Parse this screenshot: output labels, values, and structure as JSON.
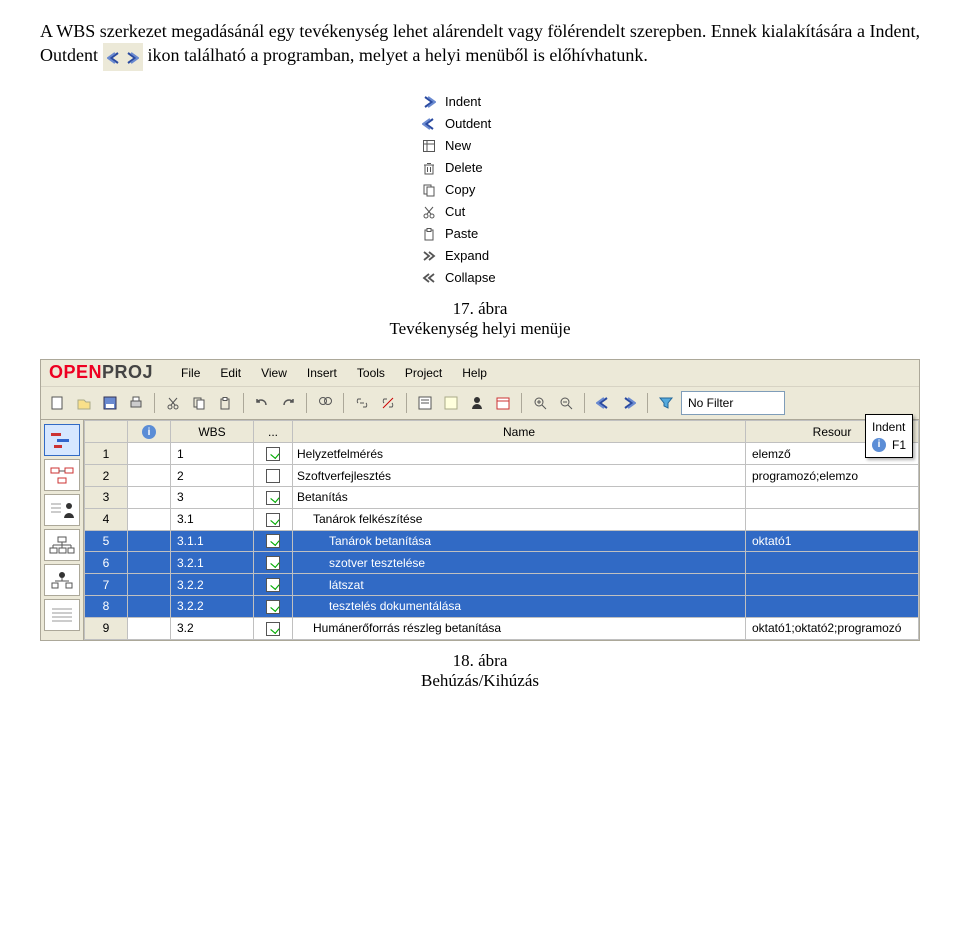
{
  "para1_a": "A WBS szerkezet megadásánál egy tevékenység lehet alárendelt vagy fölérendelt szerepben. Ennek kialakítására a Indent, Outdent",
  "para1_b": "ikon található a programban, melyet a helyi menüből is előhívhatunk.",
  "caption17_a": "17. ábra",
  "caption17_b": "Tevékenység helyi menüje",
  "caption18_a": "18. ábra",
  "caption18_b": "Behúzás/Kihúzás",
  "context_menu": {
    "items": [
      {
        "label": "Indent"
      },
      {
        "label": "Outdent"
      },
      {
        "label": "New"
      },
      {
        "label": "Delete"
      },
      {
        "label": "Copy"
      },
      {
        "label": "Cut"
      },
      {
        "label": "Paste"
      },
      {
        "label": "Expand"
      },
      {
        "label": "Collapse"
      }
    ]
  },
  "app": {
    "logo_open": "OPEN",
    "logo_proj": "PROJ",
    "menus": [
      "File",
      "Edit",
      "View",
      "Insert",
      "Tools",
      "Project",
      "Help"
    ],
    "filter_text": "No Filter",
    "tooltip": {
      "title": "Indent",
      "shortcut": "F1"
    },
    "columns": {
      "info": "",
      "wbs": "WBS",
      "dots": "...",
      "name": "Name",
      "resource": "Resour"
    },
    "rows": [
      {
        "n": "1",
        "wbs": "1",
        "chk": true,
        "name": "Helyzetfelmérés",
        "res": "elemző",
        "sel": false,
        "indent": 0
      },
      {
        "n": "2",
        "wbs": "2",
        "chk": false,
        "name": "Szoftverfejlesztés",
        "res": "programozó;elemzo",
        "sel": false,
        "indent": 0
      },
      {
        "n": "3",
        "wbs": "3",
        "chk": true,
        "name": "Betanítás",
        "res": "",
        "sel": false,
        "indent": 0
      },
      {
        "n": "4",
        "wbs": "3.1",
        "chk": true,
        "name": "Tanárok felkészítése",
        "res": "",
        "sel": false,
        "indent": 1
      },
      {
        "n": "5",
        "wbs": "3.1.1",
        "chk": true,
        "name": "Tanárok betanítása",
        "res": "oktató1",
        "sel": true,
        "indent": 2
      },
      {
        "n": "6",
        "wbs": "3.2.1",
        "chk": true,
        "name": "szotver tesztelése",
        "res": "",
        "sel": true,
        "indent": 2
      },
      {
        "n": "7",
        "wbs": "3.2.2",
        "chk": true,
        "name": "látszat",
        "res": "",
        "sel": true,
        "indent": 2
      },
      {
        "n": "8",
        "wbs": "3.2.2",
        "chk": true,
        "name": "tesztelés dokumentálása",
        "res": "",
        "sel": true,
        "indent": 2
      },
      {
        "n": "9",
        "wbs": "3.2",
        "chk": true,
        "name": "Humánerőforrás részleg betanítása",
        "res": "oktató1;oktató2;programozó",
        "sel": false,
        "indent": 1
      }
    ]
  }
}
